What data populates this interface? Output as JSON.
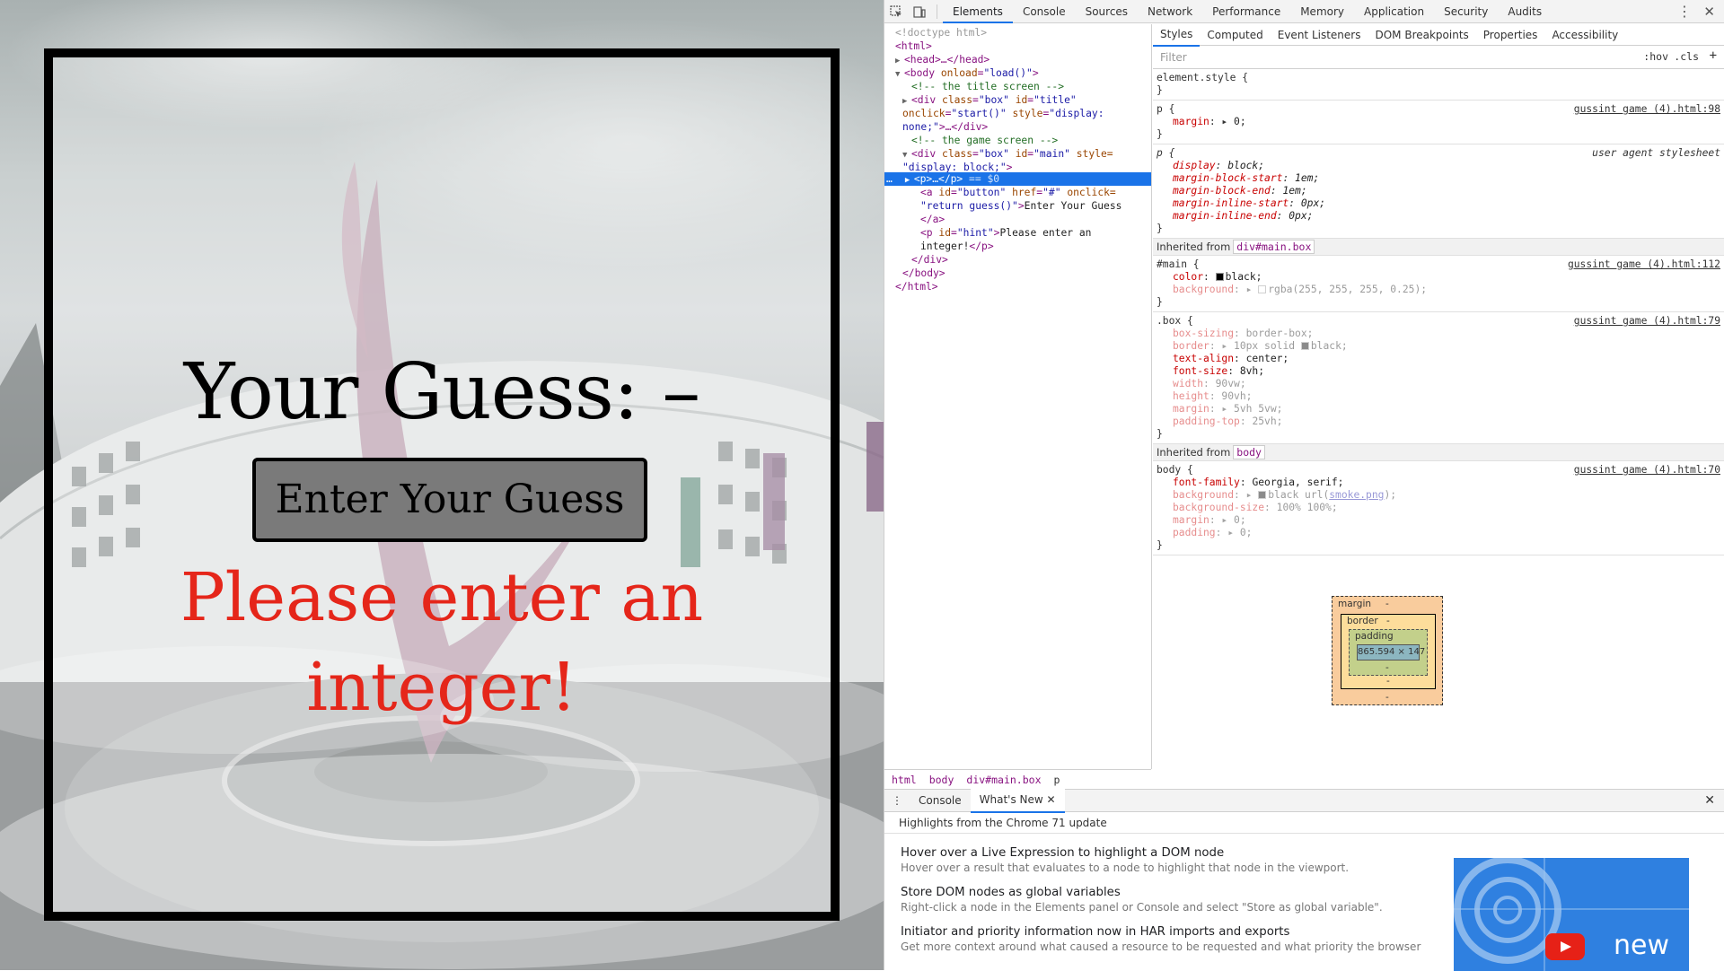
{
  "page": {
    "guess_label": "Your Guess: –",
    "button_label": "Enter Your Guess",
    "hint": "Please enter an integer!"
  },
  "devtools": {
    "main_tabs": [
      "Elements",
      "Console",
      "Sources",
      "Network",
      "Performance",
      "Memory",
      "Application",
      "Security",
      "Audits"
    ],
    "dom": {
      "doctype": "<!doctype html>",
      "html_open": "<html>",
      "head": "<head>…</head>",
      "body_open_tag": "<body",
      "body_attr": "onload",
      "body_val": "\"load()\"",
      "comment_title": "<!-- the title screen -->",
      "title_div_a": "<div",
      "title_div_class": "class",
      "title_div_class_val": "\"box\"",
      "title_div_id": "id",
      "title_div_id_val": "\"title\"",
      "title_div_onclick": "onclick",
      "title_div_onclick_val": "\"start()\"",
      "title_div_style": "style",
      "title_div_style_val": "\"display:",
      "title_div_style_val2": "none;\"",
      "title_div_end": ">…</div>",
      "comment_game": "<!-- the game screen -->",
      "main_div_a": "<div",
      "main_div_class": "class",
      "main_div_class_val": "\"box\"",
      "main_div_id": "id",
      "main_div_id_val": "\"main\"",
      "main_div_style": "style=",
      "main_div_style_val": "\"display: block;\"",
      "selected_p": "<p>…</p>",
      "selected_marker": "== $0",
      "a_tag": "<a",
      "a_id": "id",
      "a_id_val": "\"button\"",
      "a_href": "href",
      "a_href_val": "\"#\"",
      "a_onclick": "onclick=",
      "a_onclick_val": "\"return guess()\"",
      "a_text": "Enter Your Guess",
      "a_close": "</a>",
      "p_tag": "<p",
      "p_id": "id",
      "p_id_val": "\"hint\"",
      "p_text1": "Please enter an",
      "p_text2": "integer!",
      "p_close": "</p>",
      "div_close": "</div>",
      "body_close": "</body>",
      "html_close": "</html>"
    },
    "breadcrumbs": [
      "html",
      "body",
      "div#main.box",
      "p"
    ],
    "sub_tabs": [
      "Styles",
      "Computed",
      "Event Listeners",
      "DOM Breakpoints",
      "Properties",
      "Accessibility"
    ],
    "filter_placeholder": "Filter",
    "filter_hov": ":hov",
    "filter_cls": ".cls",
    "filter_add": "+",
    "rules": {
      "element_style": "element.style {",
      "close": "}",
      "p_sel": "p {",
      "p_src": "gussint game (4).html:98",
      "p_margin_name": "margin",
      "p_margin_val": "0;",
      "ua_sel": "p {",
      "ua_src": "user agent stylesheet",
      "ua_display": "display",
      "ua_display_val": "block;",
      "ua_mbs": "margin-block-start",
      "ua_mbs_val": "1em;",
      "ua_mbe": "margin-block-end",
      "ua_mbe_val": "1em;",
      "ua_mis": "margin-inline-start",
      "ua_mis_val": "0px;",
      "ua_mie": "margin-inline-end",
      "ua_mie_val": "0px;",
      "inherited_from": "Inherited from",
      "inh_main": "div#main.box",
      "main_sel": "#main {",
      "main_src": "gussint game (4).html:112",
      "main_color": "color",
      "main_color_val": "black;",
      "main_bg": "background",
      "main_bg_val": "rgba(255, 255, 255, 0.25);",
      "box_sel": ".box {",
      "box_src": "gussint game (4).html:79",
      "box_sizing": "box-sizing",
      "box_sizing_val": "border-box;",
      "box_border": "border",
      "box_border_val": "10px solid",
      "box_border_val2": "black;",
      "box_ta": "text-align",
      "box_ta_val": "center;",
      "box_fs": "font-size",
      "box_fs_val": "8vh;",
      "box_w": "width",
      "box_w_val": "90vw;",
      "box_h": "height",
      "box_h_val": "90vh;",
      "box_m": "margin",
      "box_m_val": "5vh 5vw;",
      "box_pt": "padding-top",
      "box_pt_val": "25vh;",
      "inh_body": "body",
      "body_sel": "body {",
      "body_src": "gussint game (4).html:70",
      "body_ff": "font-family",
      "body_ff_val": "Georgia, serif;",
      "body_bg": "background",
      "body_bg_val": "black url(",
      "body_bg_url": "smoke.png",
      "body_bg_end": ");",
      "body_bs": "background-size",
      "body_bs_val": "100% 100%;",
      "body_m": "margin",
      "body_m_val": "0;",
      "body_p": "padding",
      "body_p_val": "0;"
    },
    "box_model": {
      "margin": "margin",
      "border": "border",
      "padding": "padding",
      "dash": "-",
      "content": "865.594 × 147"
    },
    "drawer": {
      "tabs": [
        "Console",
        "What's New"
      ],
      "highlights": "Highlights from the Chrome 71 update",
      "items": [
        {
          "title": "Hover over a Live Expression to highlight a DOM node",
          "desc": "Hover over a result that evaluates to a node to highlight that node in the viewport."
        },
        {
          "title": "Store DOM nodes as global variables",
          "desc": "Right-click a node in the Elements panel or Console and select \"Store as global variable\"."
        },
        {
          "title": "Initiator and priority information now in HAR imports and exports",
          "desc": "Get more context around what caused a resource to be requested and what priority the browser"
        }
      ],
      "promo_text": "new"
    }
  }
}
